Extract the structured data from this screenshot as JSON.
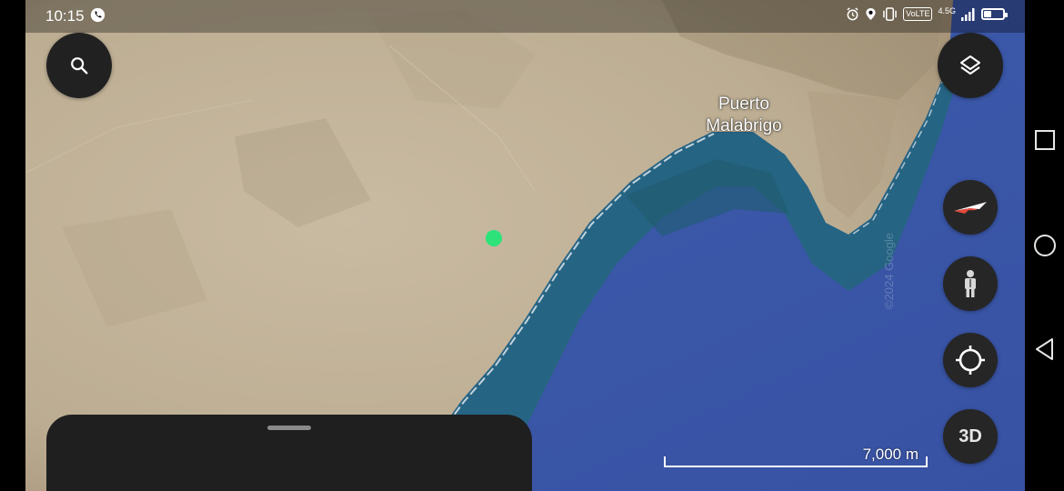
{
  "status_bar": {
    "time": "10:15",
    "network_badge": "VoLTE",
    "network_type": "4.5G",
    "battery_percent": 45,
    "icons": [
      "whatsapp-call-icon",
      "alarm-icon",
      "location-icon",
      "vibrate-icon",
      "signal-icon",
      "battery-icon"
    ]
  },
  "map": {
    "place_label_line1": "Puerto",
    "place_label_line2": "Malabrigo",
    "scale_label": "7,000 m",
    "copyright": "©2024 Google",
    "colors": {
      "land": "#c2b49c",
      "ocean": "#3a58a8",
      "shallow_water": "#23667c",
      "marker": "#2ee27a"
    }
  },
  "controls": {
    "search_icon": "search-icon",
    "layers_icon": "layers-icon",
    "compass_icon": "compass-icon",
    "street_view_icon": "pegman-icon",
    "my_location_icon": "crosshair-icon",
    "three_d_label": "3D"
  },
  "navigation": {
    "buttons": [
      "recent-apps-icon",
      "home-icon",
      "back-icon"
    ]
  }
}
